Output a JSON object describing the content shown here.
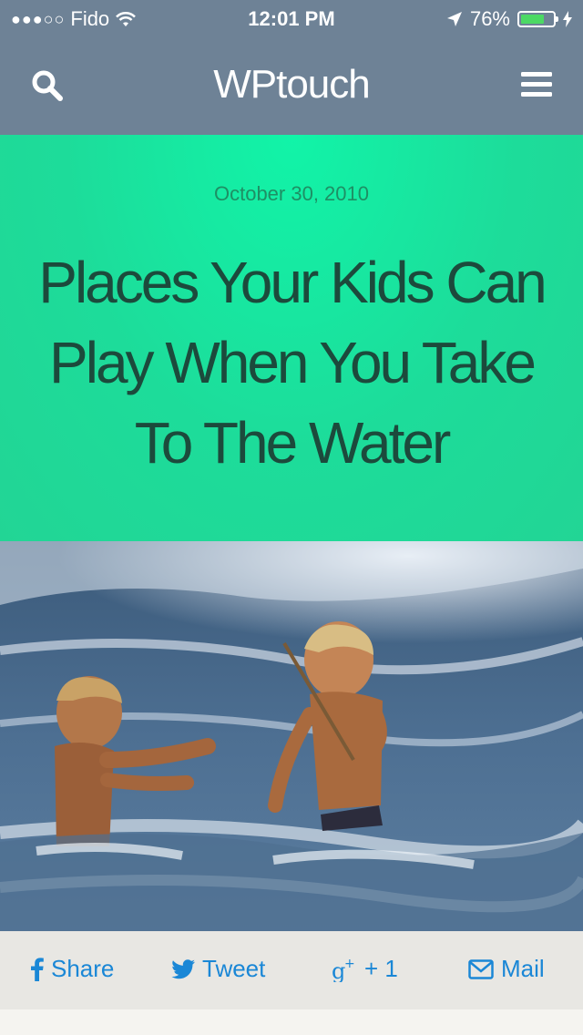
{
  "status_bar": {
    "carrier": "Fido",
    "time": "12:01 PM",
    "battery": "76%",
    "battery_level": 0.76
  },
  "header": {
    "site_title": "WPtouch"
  },
  "post": {
    "date": "October 30, 2010",
    "title": "Places Your Kids Can Play When You Take To The Water"
  },
  "share": {
    "facebook": "Share",
    "twitter": "Tweet",
    "gplus": "+ 1",
    "mail": "Mail"
  },
  "colors": {
    "header_bg": "#6e8296",
    "hero_bg": "#1ddc9a",
    "title_text": "#1c4a3c",
    "share_accent": "#1a87d6"
  },
  "icons": [
    "search-icon",
    "menu-icon",
    "facebook-icon",
    "twitter-icon",
    "google-plus-icon",
    "mail-icon",
    "location-arrow-icon",
    "wifi-icon",
    "battery-icon",
    "charging-bolt-icon"
  ]
}
